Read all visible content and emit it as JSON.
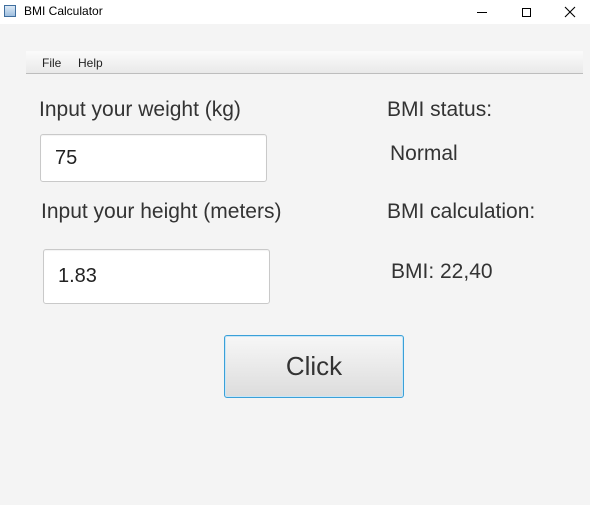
{
  "window": {
    "title": "BMI Calculator",
    "icon": "app-window-icon",
    "controls": [
      "minimize-icon",
      "maximize-icon",
      "close-icon"
    ]
  },
  "menu": {
    "file": "File",
    "help": "Help"
  },
  "weight": {
    "label": "Input your weight (kg)",
    "value": "75"
  },
  "height": {
    "label": "Input your height (meters)",
    "value": "1.83"
  },
  "status": {
    "label": "BMI status:",
    "value": "Normal"
  },
  "calculation": {
    "label": "BMI calculation:",
    "value": "BMI: 22,40"
  },
  "button": {
    "label": "Click"
  },
  "colors": {
    "background": "#f4f4f4",
    "button_focus_border": "#3aa0d8",
    "text": "#333333"
  }
}
